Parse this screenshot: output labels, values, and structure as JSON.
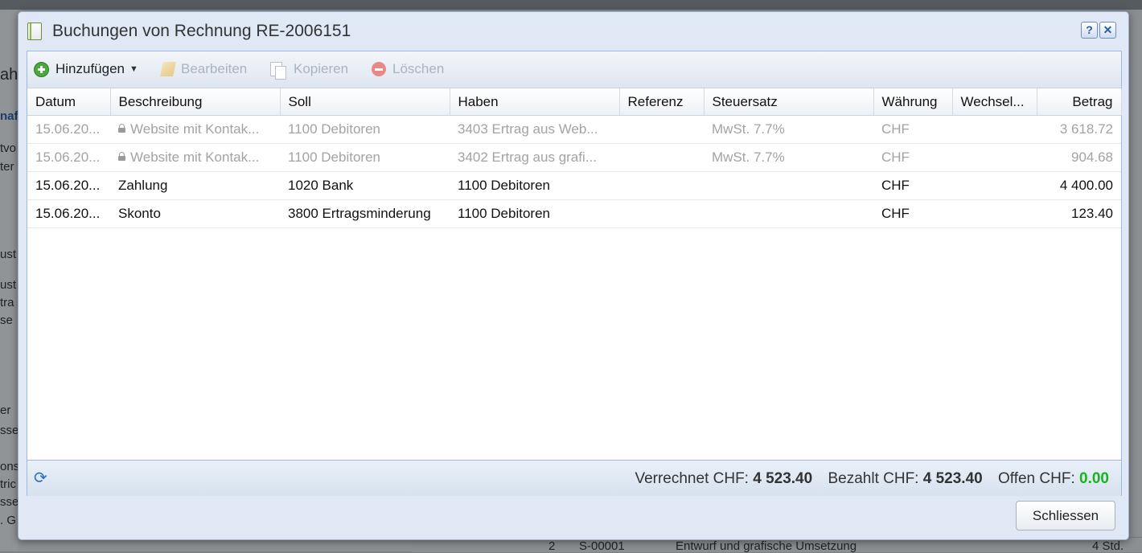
{
  "dialog": {
    "title": "Buchungen von Rechnung RE-2006151",
    "help_label": "?",
    "close_label": "✕"
  },
  "toolbar": {
    "add_label": "Hinzufügen",
    "edit_label": "Bearbeiten",
    "copy_label": "Kopieren",
    "delete_label": "Löschen"
  },
  "grid": {
    "columns": [
      "Datum",
      "Beschreibung",
      "Soll",
      "Haben",
      "Referenz",
      "Steuersatz",
      "Währung",
      "Wechsel...",
      "Betrag"
    ],
    "rows": [
      {
        "locked": true,
        "datum": "15.06.20...",
        "beschreibung": "Website mit Kontak...",
        "soll": "1100 Debitoren",
        "haben": "3403 Ertrag aus Web...",
        "referenz": "",
        "steuersatz": "MwSt. 7.7%",
        "waehrung": "CHF",
        "wechsel": "",
        "betrag": "3 618.72"
      },
      {
        "locked": true,
        "datum": "15.06.20...",
        "beschreibung": "Website mit Kontak...",
        "soll": "1100 Debitoren",
        "haben": "3402 Ertrag aus grafi...",
        "referenz": "",
        "steuersatz": "MwSt. 7.7%",
        "waehrung": "CHF",
        "wechsel": "",
        "betrag": "904.68"
      },
      {
        "locked": false,
        "datum": "15.06.20...",
        "beschreibung": "Zahlung",
        "soll": "1020 Bank",
        "haben": "1100 Debitoren",
        "referenz": "",
        "steuersatz": "",
        "waehrung": "CHF",
        "wechsel": "",
        "betrag": "4 400.00"
      },
      {
        "locked": false,
        "datum": "15.06.20...",
        "beschreibung": "Skonto",
        "soll": "3800 Ertragsminderung",
        "haben": "1100 Debitoren",
        "referenz": "",
        "steuersatz": "",
        "waehrung": "CHF",
        "wechsel": "",
        "betrag": "123.40"
      }
    ]
  },
  "summary": {
    "verrechnet_label": "Verrechnet CHF:",
    "verrechnet_value": "4 523.40",
    "bezahlt_label": "Bezahlt CHF:",
    "bezahlt_value": "4 523.40",
    "offen_label": "Offen CHF:",
    "offen_value": "0.00",
    "offen_color": "#19b31f"
  },
  "footer": {
    "close_button_label": "Schliessen"
  },
  "background": {
    "left_fragments": [
      "ah",
      "naf",
      "tvo",
      "ter",
      "ust",
      "ust",
      "tra",
      "se",
      "er",
      "sse",
      "ons",
      "tric",
      "sse",
      ". G"
    ],
    "bottom_texts": [
      "2",
      "S-00001",
      "Entwurf und grafische Umsetzung",
      "4 Std."
    ]
  }
}
